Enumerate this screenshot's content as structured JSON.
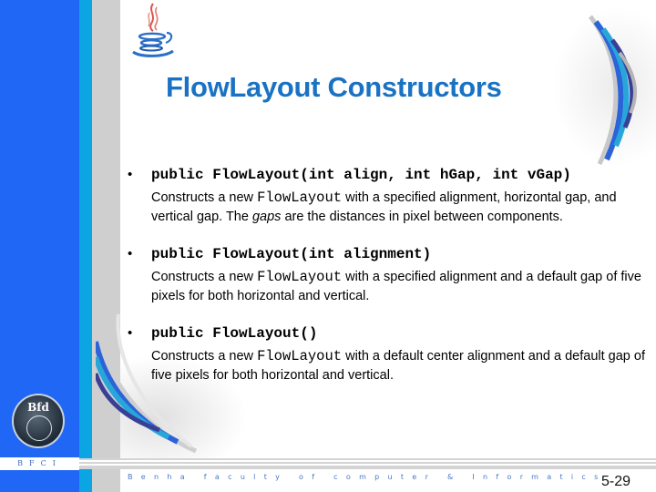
{
  "slide": {
    "title": "FlowLayout Constructors",
    "page_number": "5-29",
    "footer_text": "Benha faculty of computer & Informatics",
    "sidebar_label": "BFCI",
    "logo_text": "Bfd",
    "accent_color": "#1a72c4",
    "sidebar_color": "#2067f5"
  },
  "constructors": [
    {
      "signature": "public FlowLayout(int align, int hGap, int vGap)",
      "desc_prefix": "Constructs a new ",
      "desc_code": "FlowLayout",
      "desc_mid": " with a specified alignment, horizontal gap, and vertical gap.  The ",
      "desc_em": "gaps",
      "desc_suffix": " are the distances in pixel between components."
    },
    {
      "signature": "public FlowLayout(int alignment)",
      "desc_prefix": "Constructs a new ",
      "desc_code": "FlowLayout",
      "desc_mid": " with a specified alignment and a default gap of five pixels for both horizontal and vertical.",
      "desc_em": "",
      "desc_suffix": ""
    },
    {
      "signature": "public FlowLayout()",
      "desc_prefix": "Constructs a new ",
      "desc_code": "FlowLayout",
      "desc_mid": " with a default center alignment and a default gap of five pixels for both horizontal and vertical.",
      "desc_em": "",
      "desc_suffix": ""
    }
  ],
  "icons": {
    "java_logo": "java-coffee-cup-icon",
    "college_logo": "bfci-globe-logo"
  }
}
